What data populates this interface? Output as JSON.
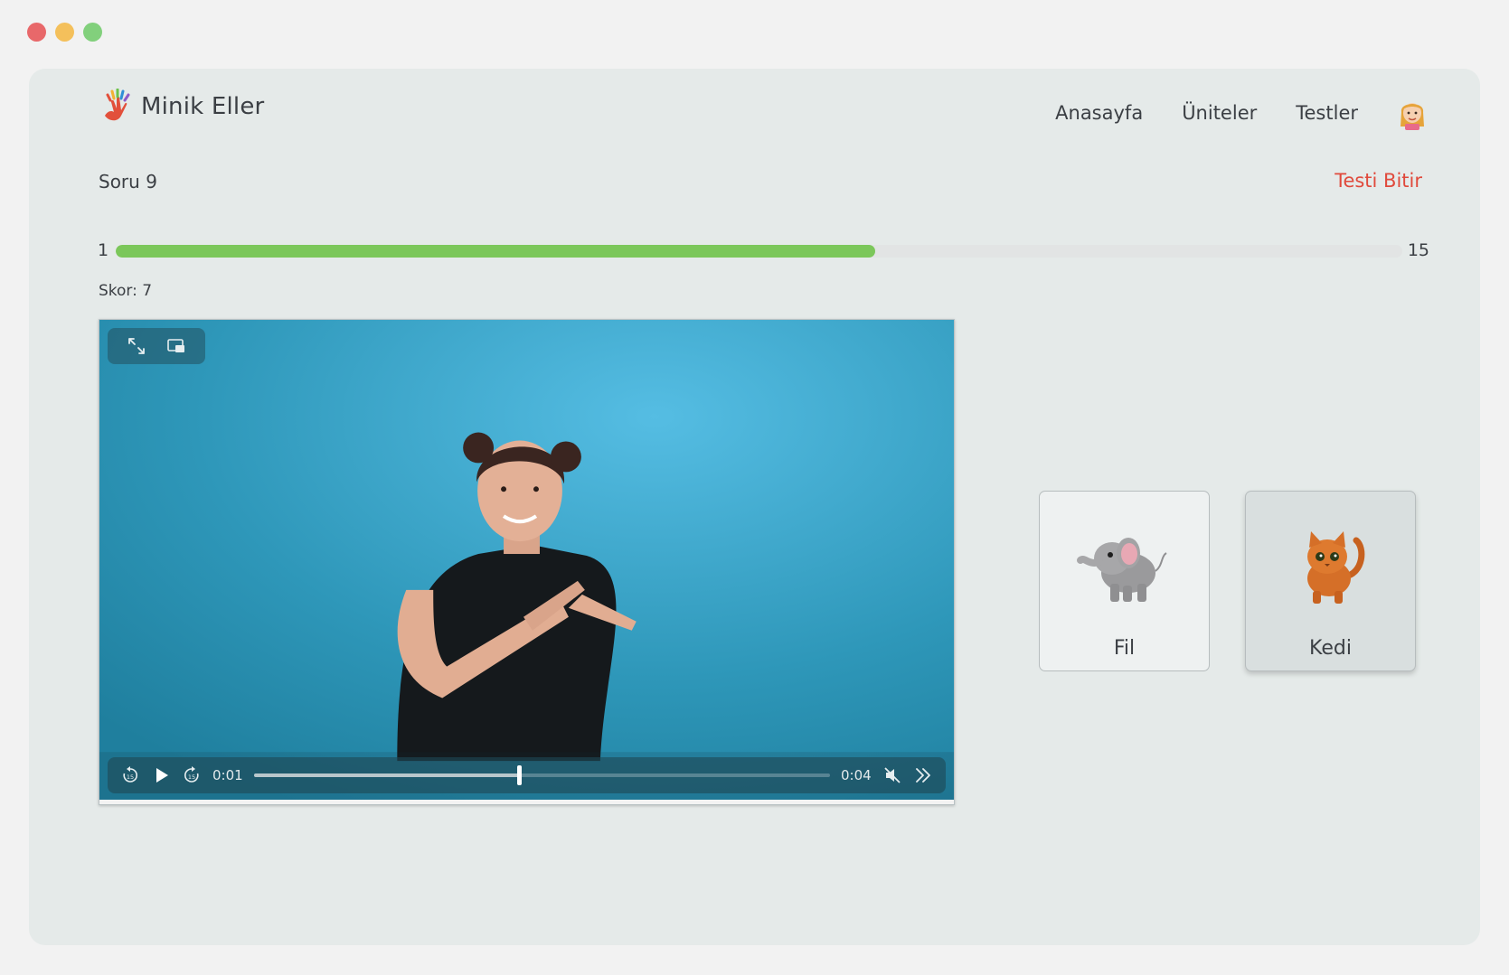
{
  "app": {
    "name": "Minik Eller"
  },
  "nav": {
    "home": "Anasayfa",
    "units": "Üniteler",
    "tests": "Testler"
  },
  "quiz": {
    "question_label": "Soru 9",
    "finish_label": "Testi Bitir",
    "progress_start": "1",
    "progress_end": "15",
    "progress_fraction": 0.59,
    "score_label": "Skor: 7"
  },
  "video": {
    "current_time": "0:01",
    "duration": "0:04",
    "seek_fraction": 0.46,
    "icons": [
      "fullscreen-icon",
      "picture-in-picture-icon",
      "rewind-15-icon",
      "play-icon",
      "forward-15-icon",
      "mute-icon",
      "skip-forward-icon"
    ]
  },
  "answers": [
    {
      "label": "Fil",
      "icon": "elephant-icon",
      "selected": false
    },
    {
      "label": "Kedi",
      "icon": "cat-icon",
      "selected": true
    }
  ],
  "colors": {
    "accent_green": "#7bc75a",
    "finish_red": "#e04a3c",
    "video_bg": "#3aa0c0"
  }
}
